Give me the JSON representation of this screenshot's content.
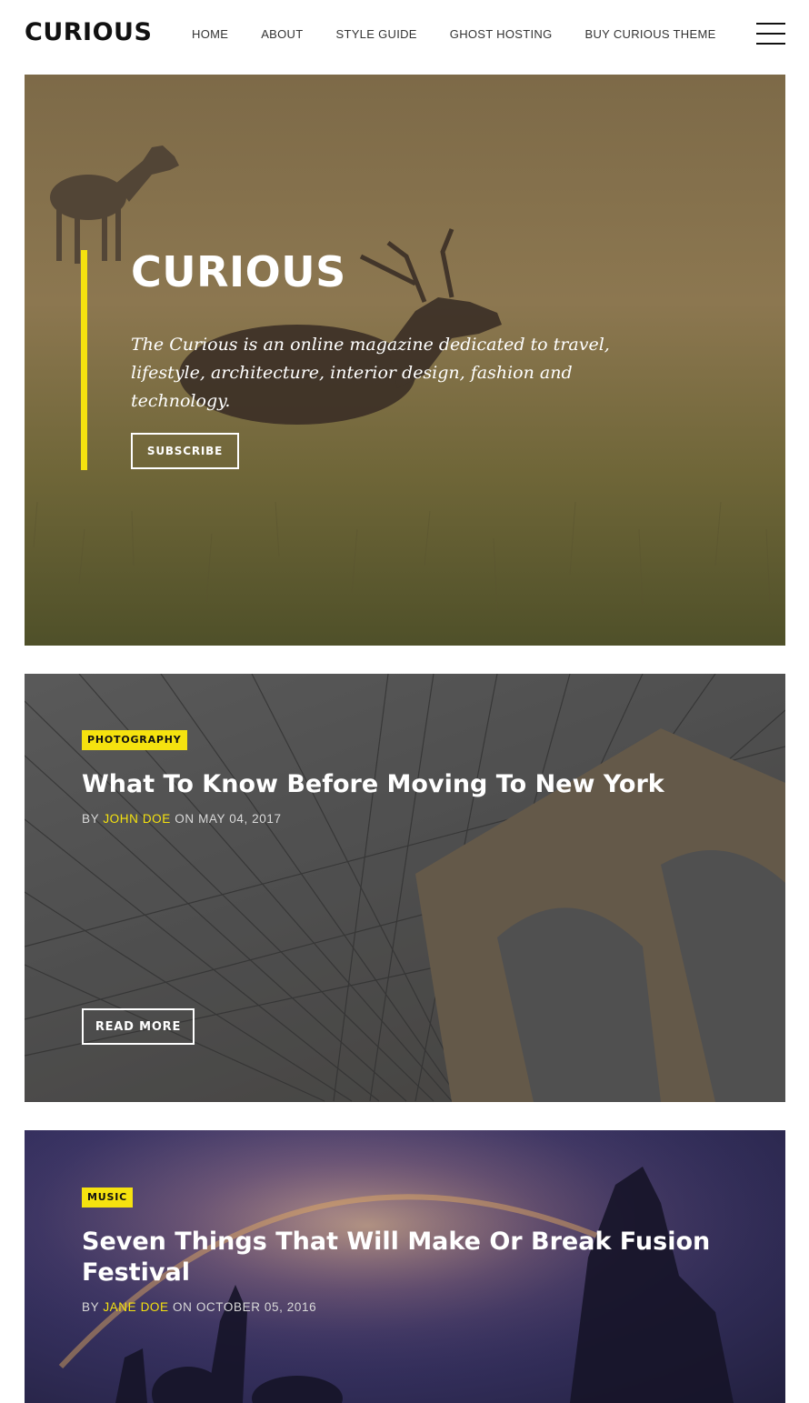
{
  "header": {
    "logo": "CURIOUS",
    "nav": [
      "HOME",
      "ABOUT",
      "STYLE GUIDE",
      "GHOST HOSTING",
      "BUY CURIOUS THEME"
    ],
    "menu_icon": "hamburger-menu-icon"
  },
  "hero": {
    "title": "CURIOUS",
    "description": "The Curious is an online magazine dedicated to travel, lifestyle, architecture, interior design, fashion and technology.",
    "button": "SUBSCRIBE",
    "accent_color": "#f5e20f"
  },
  "posts": [
    {
      "tag": "PHOTOGRAPHY",
      "title": "What To Know Before Moving To New York",
      "by": "BY",
      "author": "JOHN DOE",
      "on": "ON",
      "date": "MAY 04, 2017",
      "button": "READ MORE"
    },
    {
      "tag": "MUSIC",
      "title": "Seven Things That Will Make Or Break Fusion Festival",
      "by": "BY",
      "author": "JANE DOE",
      "on": "ON",
      "date": "OCTOBER 05, 2016"
    }
  ],
  "colors": {
    "accent": "#f5e20f",
    "text_dark": "#111111",
    "white": "#ffffff"
  }
}
